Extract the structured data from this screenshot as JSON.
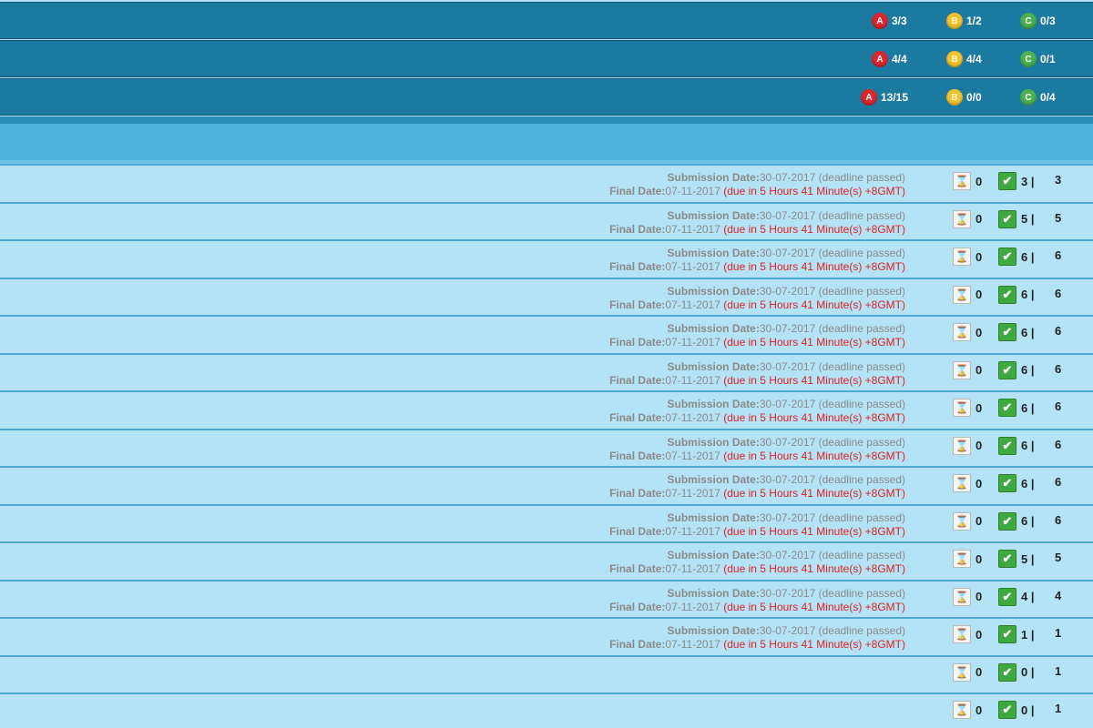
{
  "summary": [
    {
      "a": "3/3",
      "b": "1/2",
      "c": "0/3"
    },
    {
      "a": "4/4",
      "b": "4/4",
      "c": "0/1"
    },
    {
      "a": "13/15",
      "b": "0/0",
      "c": "0/4"
    }
  ],
  "badges": {
    "a": "A",
    "b": "B",
    "c": "C"
  },
  "labels": {
    "submission": "Submission Date:",
    "final": "Final Date:"
  },
  "rows": [
    {
      "submission_date": "30-07-2017",
      "submission_note": "(deadline passed)",
      "final_date": "07-11-2017",
      "final_note": "(due in 5 Hours 41 Minute(s) +8GMT)",
      "pending": "0",
      "done": "3 |",
      "total": "3"
    },
    {
      "submission_date": "30-07-2017",
      "submission_note": "(deadline passed)",
      "final_date": "07-11-2017",
      "final_note": "(due in 5 Hours 41 Minute(s) +8GMT)",
      "pending": "0",
      "done": "5 |",
      "total": "5"
    },
    {
      "submission_date": "30-07-2017",
      "submission_note": "(deadline passed)",
      "final_date": "07-11-2017",
      "final_note": "(due in 5 Hours 41 Minute(s) +8GMT)",
      "pending": "0",
      "done": "6 |",
      "total": "6"
    },
    {
      "submission_date": "30-07-2017",
      "submission_note": "(deadline passed)",
      "final_date": "07-11-2017",
      "final_note": "(due in 5 Hours 41 Minute(s) +8GMT)",
      "pending": "0",
      "done": "6 |",
      "total": "6"
    },
    {
      "submission_date": "30-07-2017",
      "submission_note": "(deadline passed)",
      "final_date": "07-11-2017",
      "final_note": "(due in 5 Hours 41 Minute(s) +8GMT)",
      "pending": "0",
      "done": "6 |",
      "total": "6"
    },
    {
      "submission_date": "30-07-2017",
      "submission_note": "(deadline passed)",
      "final_date": "07-11-2017",
      "final_note": "(due in 5 Hours 41 Minute(s) +8GMT)",
      "pending": "0",
      "done": "6 |",
      "total": "6"
    },
    {
      "submission_date": "30-07-2017",
      "submission_note": "(deadline passed)",
      "final_date": "07-11-2017",
      "final_note": "(due in 5 Hours 41 Minute(s) +8GMT)",
      "pending": "0",
      "done": "6 |",
      "total": "6"
    },
    {
      "submission_date": "30-07-2017",
      "submission_note": "(deadline passed)",
      "final_date": "07-11-2017",
      "final_note": "(due in 5 Hours 41 Minute(s) +8GMT)",
      "pending": "0",
      "done": "6 |",
      "total": "6"
    },
    {
      "submission_date": "30-07-2017",
      "submission_note": "(deadline passed)",
      "final_date": "07-11-2017",
      "final_note": "(due in 5 Hours 41 Minute(s) +8GMT)",
      "pending": "0",
      "done": "6 |",
      "total": "6"
    },
    {
      "submission_date": "30-07-2017",
      "submission_note": "(deadline passed)",
      "final_date": "07-11-2017",
      "final_note": "(due in 5 Hours 41 Minute(s) +8GMT)",
      "pending": "0",
      "done": "6 |",
      "total": "6"
    },
    {
      "submission_date": "30-07-2017",
      "submission_note": "(deadline passed)",
      "final_date": "07-11-2017",
      "final_note": "(due in 5 Hours 41 Minute(s) +8GMT)",
      "pending": "0",
      "done": "5 |",
      "total": "5"
    },
    {
      "submission_date": "30-07-2017",
      "submission_note": "(deadline passed)",
      "final_date": "07-11-2017",
      "final_note": "(due in 5 Hours 41 Minute(s) +8GMT)",
      "pending": "0",
      "done": "4 |",
      "total": "4"
    },
    {
      "submission_date": "30-07-2017",
      "submission_note": "(deadline passed)",
      "final_date": "07-11-2017",
      "final_note": "(due in 5 Hours 41 Minute(s) +8GMT)",
      "pending": "0",
      "done": "1 |",
      "total": "1"
    },
    {
      "pending": "0",
      "done": "0 |",
      "total": "1"
    },
    {
      "pending": "0",
      "done": "0 |",
      "total": "1"
    }
  ]
}
